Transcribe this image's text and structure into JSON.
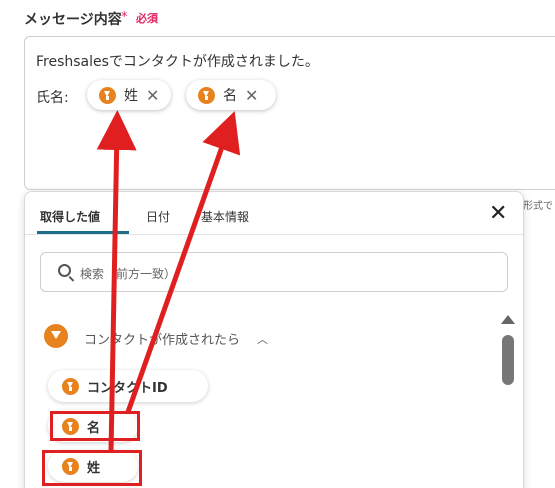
{
  "field": {
    "label": "メッセージ内容",
    "required_star": "*",
    "required_text": "必須"
  },
  "message": {
    "line1": "Freshsalesでコンタクトが作成されました。",
    "line2_label": "氏名:"
  },
  "chips": [
    {
      "label": "姓",
      "remove": "✕"
    },
    {
      "label": "名",
      "remove": "✕"
    }
  ],
  "side_text": "形式で",
  "panel": {
    "tabs": [
      "取得した値",
      "日付",
      "基本情報"
    ],
    "active_tab": "取得した値",
    "close": "✕",
    "search_placeholder": "検索（前方一致）",
    "group": {
      "label": "コンタクトが作成されたら",
      "chevron": "︿"
    },
    "items": [
      "コンタクトID",
      "名",
      "姓"
    ]
  },
  "colors": {
    "accent": "#e8821f",
    "annotation": "#e02020",
    "tab_underline": "#1f6f8b",
    "required": "#e0245e"
  }
}
